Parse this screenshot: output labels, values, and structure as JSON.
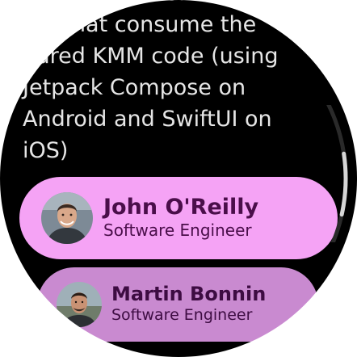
{
  "description": {
    "text": "involvement of\nnts that consume the\nhared KMM code (using\nJetpack Compose on\nAndroid and SwiftUI on\niOS)",
    "color": "#e6e6e6"
  },
  "speakers": [
    {
      "name": "John O'Reilly",
      "title": "Software Engineer",
      "avatar_icon": "person-photo-john",
      "chip_color": "#f5a3f5",
      "text_color": "#4a0e4a"
    },
    {
      "name": "Martin Bonnin",
      "title": "Software Engineer",
      "avatar_icon": "person-photo-martin",
      "chip_color": "#c98ad0",
      "text_color": "#3d0c42"
    }
  ],
  "scrollbar": {
    "position": 0.55,
    "track_color": "#2a2a2a",
    "thumb_color": "#d6d6d6"
  }
}
